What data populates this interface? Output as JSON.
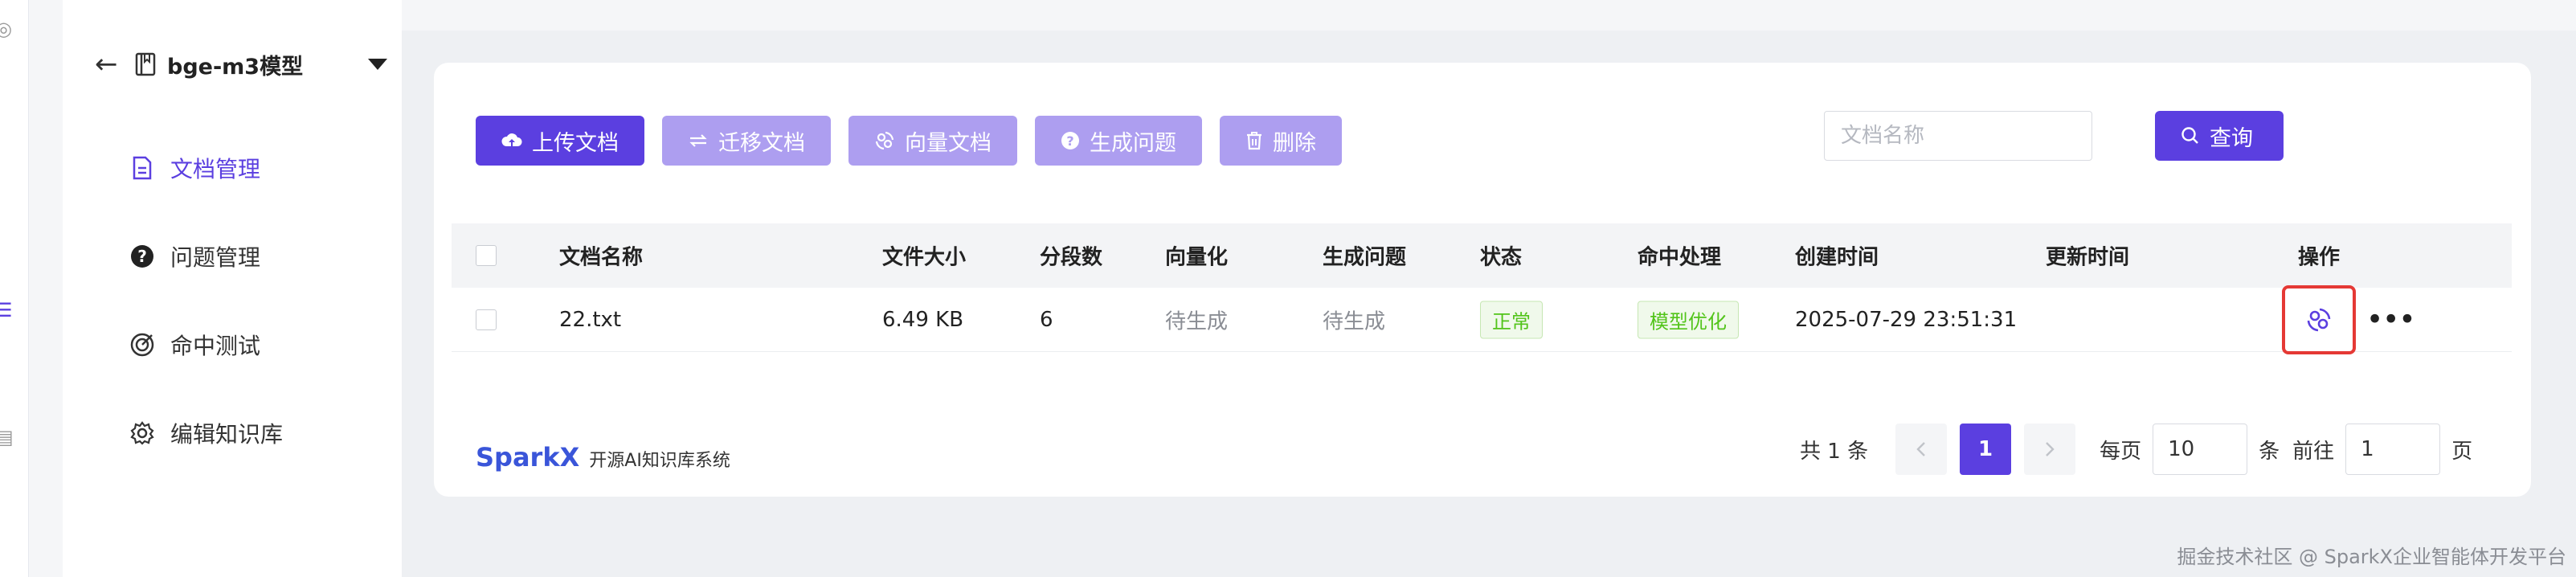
{
  "sidebar": {
    "kb_name": "bge-m3模型",
    "items": [
      {
        "label": "文档管理"
      },
      {
        "label": "问题管理"
      },
      {
        "label": "命中测试"
      },
      {
        "label": "编辑知识库"
      }
    ]
  },
  "toolbar": {
    "upload_label": "上传文档",
    "migrate_label": "迁移文档",
    "vectorize_label": "向量文档",
    "generate_label": "生成问题",
    "delete_label": "删除"
  },
  "search": {
    "placeholder": "文档名称",
    "button_label": "查询"
  },
  "table": {
    "headers": [
      "文档名称",
      "文件大小",
      "分段数",
      "向量化",
      "生成问题",
      "状态",
      "命中处理",
      "创建时间",
      "更新时间",
      "操作"
    ],
    "rows": [
      {
        "name": "22.txt",
        "size": "6.49 KB",
        "segments": "6",
        "vectorize": "待生成",
        "generate": "待生成",
        "status": "正常",
        "hit": "模型优化",
        "created": "2025-07-29 23:51:31",
        "updated": ""
      }
    ]
  },
  "brand": {
    "logo": "SparkX",
    "subtitle": "开源AI知识库系统"
  },
  "pagination": {
    "total_text": "共 1 条",
    "current_page": "1",
    "per_page_label": "每页",
    "per_page_value": "10",
    "per_page_unit": "条",
    "goto_label": "前往",
    "goto_value": "1",
    "goto_unit": "页"
  },
  "watermark": "掘金技术社区 @ SparkX企业智能体开发平台",
  "colors": {
    "primary": "#5b3fe0",
    "primary_light": "#ad9ef0",
    "status_green": "#52c41a",
    "highlight_red": "#e53935"
  }
}
